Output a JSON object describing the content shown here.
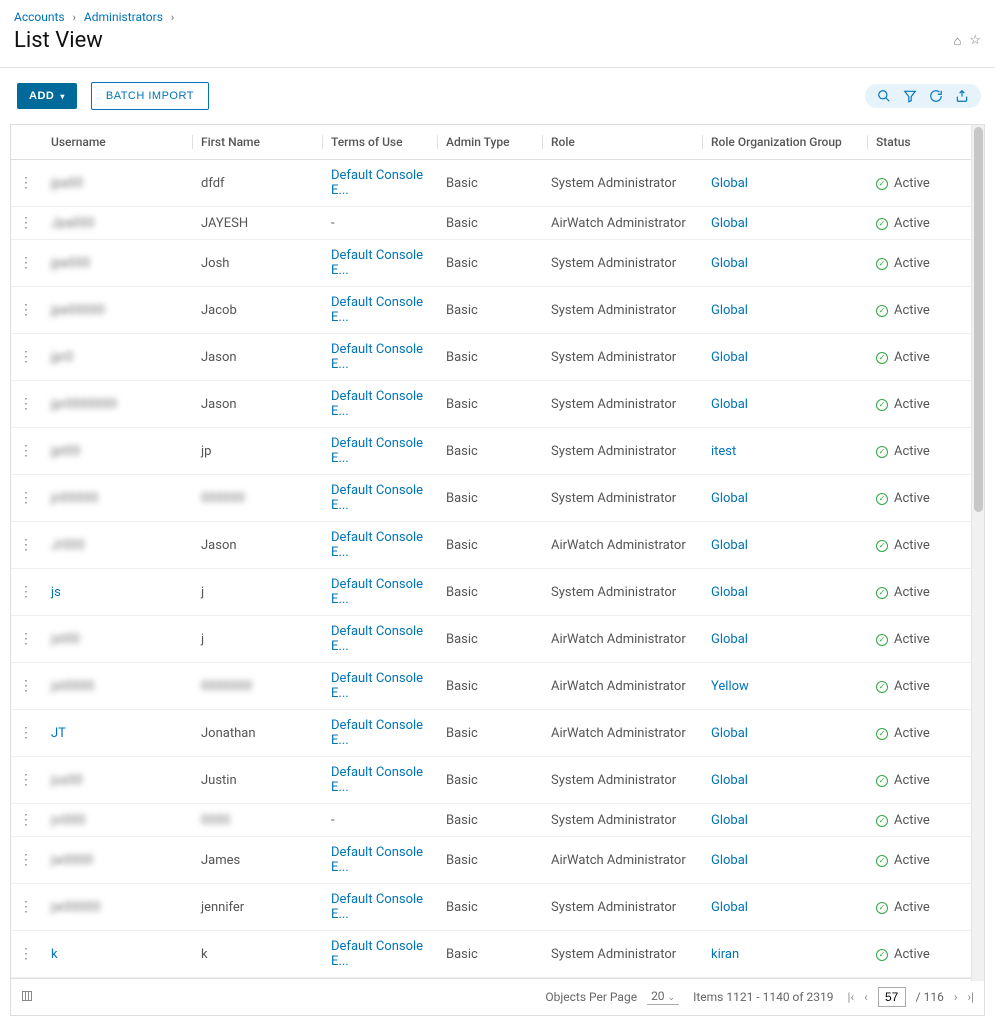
{
  "breadcrumb": {
    "accounts": "Accounts",
    "administrators": "Administrators"
  },
  "page_title": "List View",
  "buttons": {
    "add": "ADD",
    "batch_import": "BATCH IMPORT"
  },
  "columns": {
    "username": "Username",
    "first_name": "First Name",
    "terms": "Terms of Use",
    "admin_type": "Admin Type",
    "role": "Role",
    "role_org_group": "Role Organization Group",
    "status": "Status"
  },
  "rows": [
    {
      "username": "jpa00",
      "first": "dfdf",
      "terms": "Default Console E...",
      "type": "Basic",
      "role": "System Administrator",
      "group": "Global",
      "status": "Active",
      "blurU": true
    },
    {
      "username": "Jpa000",
      "first": "JAYESH",
      "terms": "-",
      "type": "Basic",
      "role": "AirWatch Administrator",
      "group": "Global",
      "status": "Active",
      "blurU": true
    },
    {
      "username": "jpe000",
      "first": "Josh",
      "terms": "Default Console E...",
      "type": "Basic",
      "role": "System Administrator",
      "group": "Global",
      "status": "Active",
      "blurU": true
    },
    {
      "username": "jpe00000",
      "first": "Jacob",
      "terms": "Default Console E...",
      "type": "Basic",
      "role": "System Administrator",
      "group": "Global",
      "status": "Active",
      "blurU": true
    },
    {
      "username": "jpr0",
      "first": "Jason",
      "terms": "Default Console E...",
      "type": "Basic",
      "role": "System Administrator",
      "group": "Global",
      "status": "Active",
      "blurU": true
    },
    {
      "username": "jpr0000000",
      "first": "Jason",
      "terms": "Default Console E...",
      "type": "Basic",
      "role": "System Administrator",
      "group": "Global",
      "status": "Active",
      "blurU": true
    },
    {
      "username": "jpt00",
      "first": "jp",
      "terms": "Default Console E...",
      "type": "Basic",
      "role": "System Administrator",
      "group": "itest",
      "status": "Active",
      "blurU": true
    },
    {
      "username": "jri00000",
      "first": "000000",
      "terms": "Default Console E...",
      "type": "Basic",
      "role": "System Administrator",
      "group": "Global",
      "status": "Active",
      "blurU": true,
      "blurF": true
    },
    {
      "username": "Jr000",
      "first": "Jason",
      "terms": "Default Console E...",
      "type": "Basic",
      "role": "AirWatch Administrator",
      "group": "Global",
      "status": "Active",
      "blurU": true
    },
    {
      "username": "js",
      "first": "j",
      "terms": "Default Console E...",
      "type": "Basic",
      "role": "System Administrator",
      "group": "Global",
      "status": "Active"
    },
    {
      "username": "jst00",
      "first": "j",
      "terms": "Default Console E...",
      "type": "Basic",
      "role": "AirWatch Administrator",
      "group": "Global",
      "status": "Active",
      "blurU": true
    },
    {
      "username": "jst0000",
      "first": "0000000",
      "terms": "Default Console E...",
      "type": "Basic",
      "role": "AirWatch Administrator",
      "group": "Yellow",
      "status": "Active",
      "blurU": true,
      "blurF": true
    },
    {
      "username": "JT",
      "first": "Jonathan",
      "terms": "Default Console E...",
      "type": "Basic",
      "role": "AirWatch Administrator",
      "group": "Global",
      "status": "Active"
    },
    {
      "username": "jus00",
      "first": "Justin",
      "terms": "Default Console E...",
      "type": "Basic",
      "role": "System Administrator",
      "group": "Global",
      "status": "Active",
      "blurU": true
    },
    {
      "username": "jvi000",
      "first": "0000",
      "terms": "-",
      "type": "Basic",
      "role": "System Administrator",
      "group": "Global",
      "status": "Active",
      "blurU": true,
      "blurF": true
    },
    {
      "username": "jw0000",
      "first": "James",
      "terms": "Default Console E...",
      "type": "Basic",
      "role": "AirWatch Administrator",
      "group": "Global",
      "status": "Active",
      "blurU": true
    },
    {
      "username": "jw00000",
      "first": "jennifer",
      "terms": "Default Console E...",
      "type": "Basic",
      "role": "System Administrator",
      "group": "Global",
      "status": "Active",
      "blurU": true
    },
    {
      "username": "k",
      "first": "k",
      "terms": "Default Console E...",
      "type": "Basic",
      "role": "System Administrator",
      "group": "kiran",
      "status": "Active"
    }
  ],
  "footer": {
    "per_page_label": "Objects Per Page",
    "per_page_value": "20",
    "range_text": "Items 1121 - 1140 of 2319",
    "current_page": "57",
    "total_pages": "/ 116"
  }
}
